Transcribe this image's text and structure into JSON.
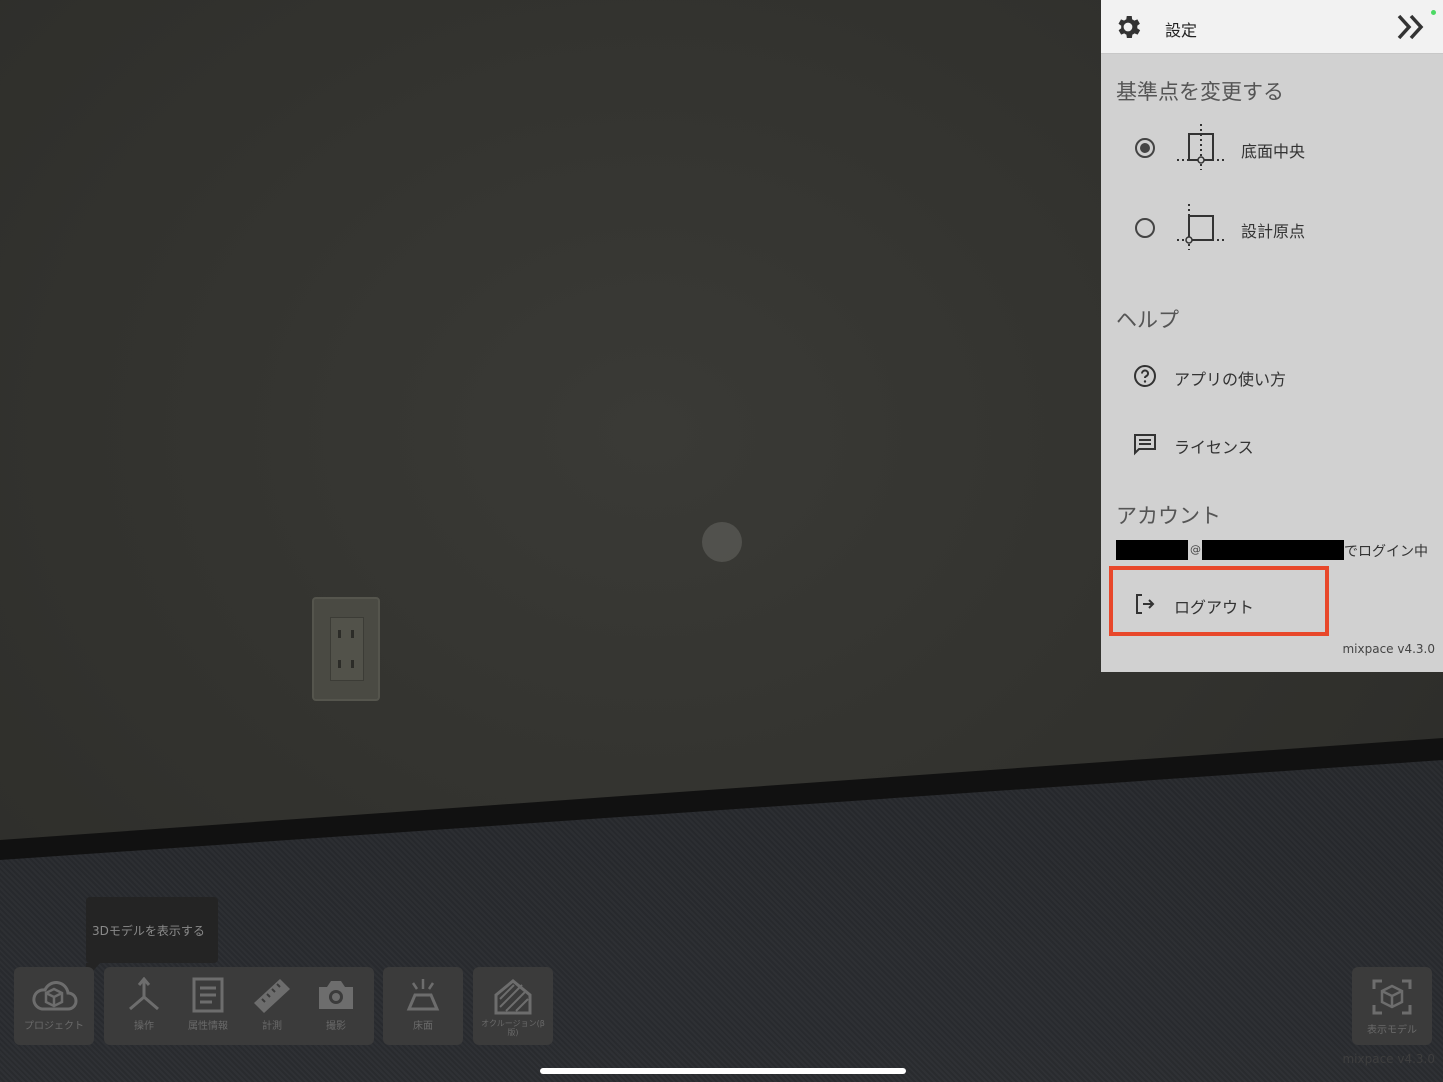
{
  "toolbar": {
    "tooltip": "3Dモデルを表示する",
    "items": [
      {
        "label": "プロジェクト",
        "icon": "cloud-box-icon"
      },
      {
        "label": "操作",
        "icon": "axes-icon"
      },
      {
        "label": "属性情報",
        "icon": "document-icon"
      },
      {
        "label": "計測",
        "icon": "ruler-icon"
      },
      {
        "label": "撮影",
        "icon": "camera-icon"
      },
      {
        "label": "床面",
        "icon": "floor-icon"
      },
      {
        "label": "オクルージョン(β版)",
        "icon": "occlusion-icon"
      },
      {
        "label": "表示モデル",
        "icon": "model-view-icon"
      }
    ],
    "ghost_version": "mixpace v4.3.0"
  },
  "settings": {
    "title": "設定",
    "base_point": {
      "heading": "基準点を変更する",
      "options": [
        {
          "label": "底面中央",
          "selected": true
        },
        {
          "label": "設計原点",
          "selected": false
        }
      ]
    },
    "help": {
      "heading": "ヘルプ",
      "items": [
        {
          "label": "アプリの使い方",
          "icon": "question-circle-icon"
        },
        {
          "label": "ライセンス",
          "icon": "message-lines-icon"
        }
      ]
    },
    "account": {
      "heading": "アカウント",
      "at_sign": "@",
      "status": "でログイン中",
      "logout_label": "ログアウト"
    },
    "version": "mixpace v4.3.0"
  },
  "colors": {
    "highlight": "#e8472a",
    "status_dot": "#4cd964"
  }
}
